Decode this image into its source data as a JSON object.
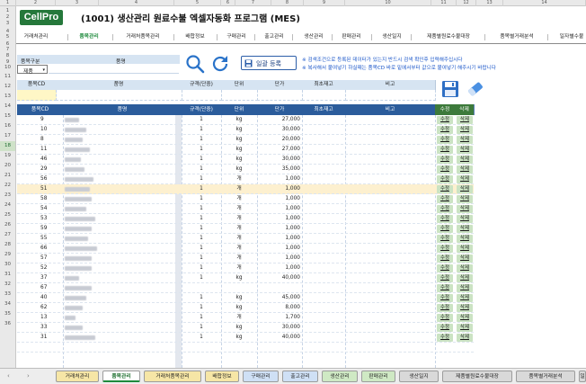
{
  "columns": [
    "1",
    "2",
    "3",
    "4",
    "5",
    "6",
    "7",
    "8",
    "9",
    "10",
    "11",
    "12",
    "13",
    "14"
  ],
  "rows": [
    "1",
    "2",
    "3",
    "4",
    "5",
    "6",
    "7",
    "8",
    "9",
    "10",
    "11",
    "12",
    "13",
    "14",
    "15",
    "16",
    "17",
    "18",
    "19",
    "20",
    "21",
    "22",
    "23",
    "24",
    "25",
    "26",
    "27",
    "28",
    "29",
    "30",
    "31",
    "32",
    "33",
    "34",
    "35",
    "36"
  ],
  "selected_row": "18",
  "logo": "CellPro",
  "title": "(1001) 생산관리 원료수불 엑셀자동화 프로그램 (MES)",
  "nav": [
    {
      "label": "거래처관리",
      "active": false
    },
    {
      "label": "품목관리",
      "active": true
    },
    {
      "label": "거래처품목관리",
      "active": false
    },
    {
      "label": "배합정보",
      "active": false
    },
    {
      "label": "구매관리",
      "active": false
    },
    {
      "label": "출고관리",
      "active": false
    },
    {
      "label": "생산관리",
      "active": false
    },
    {
      "label": "판매관리",
      "active": false
    },
    {
      "label": "생산일지",
      "active": false
    },
    {
      "label": "제품별원료수불대장",
      "active": false
    },
    {
      "label": "품목별거래분석",
      "active": false
    },
    {
      "label": "일자별수불",
      "active": false
    }
  ],
  "search": {
    "type_label": "품목구분",
    "name_label": "품명",
    "type_value": "제품",
    "register_label": "일괄 등록"
  },
  "notices": [
    "※ 검색조건으로 등록된 데이터가 있는지 반드시 검색 확인후 입력해주십시다",
    "※ 복사해서 붙여넣기 하실때는 품목CD 바로 밑에서부터 값으로 붙여넣기 해주시기 바랍니다"
  ],
  "entry_headers": [
    "품목CD",
    "품명",
    "규격(단중)",
    "단위",
    "단가",
    "최초재고",
    "비고"
  ],
  "table_headers": {
    "code": "품목CD",
    "name": "품명",
    "spec": "규격(단중)",
    "unit": "단위",
    "price": "단가",
    "stock": "최초재고",
    "note": "비고",
    "edit": "수정",
    "delete": "삭제"
  },
  "action_labels": {
    "edit": "수정",
    "delete": "삭제"
  },
  "table_rows": [
    {
      "code": "9",
      "name": "",
      "spec": "1",
      "unit": "kg",
      "price": "27,000"
    },
    {
      "code": "10",
      "name": "",
      "spec": "1",
      "unit": "kg",
      "price": "30,000"
    },
    {
      "code": "8",
      "name": "",
      "spec": "1",
      "unit": "kg",
      "price": "20,000"
    },
    {
      "code": "11",
      "name": "",
      "spec": "1",
      "unit": "kg",
      "price": "27,000"
    },
    {
      "code": "46",
      "name": "",
      "spec": "1",
      "unit": "kg",
      "price": "30,000"
    },
    {
      "code": "29",
      "name": "",
      "spec": "1",
      "unit": "kg",
      "price": "35,000"
    },
    {
      "code": "56",
      "name": "",
      "spec": "1",
      "unit": "개",
      "price": "1,000"
    },
    {
      "code": "51",
      "name": "",
      "spec": "1",
      "unit": "개",
      "price": "1,000"
    },
    {
      "code": "58",
      "name": "",
      "spec": "1",
      "unit": "개",
      "price": "1,000"
    },
    {
      "code": "54",
      "name": "",
      "spec": "1",
      "unit": "개",
      "price": "1,000"
    },
    {
      "code": "53",
      "name": "",
      "spec": "1",
      "unit": "개",
      "price": "1,000"
    },
    {
      "code": "59",
      "name": "",
      "spec": "1",
      "unit": "개",
      "price": "1,000"
    },
    {
      "code": "55",
      "name": "",
      "spec": "1",
      "unit": "개",
      "price": "1,000"
    },
    {
      "code": "66",
      "name": "",
      "spec": "1",
      "unit": "개",
      "price": "1,000"
    },
    {
      "code": "57",
      "name": "",
      "spec": "1",
      "unit": "개",
      "price": "1,000"
    },
    {
      "code": "52",
      "name": "",
      "spec": "1",
      "unit": "개",
      "price": "1,000"
    },
    {
      "code": "37",
      "name": "",
      "spec": "1",
      "unit": "kg",
      "price": "40,000"
    },
    {
      "code": "67",
      "name": "",
      "spec": "",
      "unit": "",
      "price": ""
    },
    {
      "code": "40",
      "name": "",
      "spec": "1",
      "unit": "kg",
      "price": "45,000"
    },
    {
      "code": "62",
      "name": "",
      "spec": "1",
      "unit": "kg",
      "price": "8,000"
    },
    {
      "code": "13",
      "name": "",
      "spec": "1",
      "unit": "개",
      "price": "1,700"
    },
    {
      "code": "33",
      "name": "",
      "spec": "1",
      "unit": "kg",
      "price": "30,000"
    },
    {
      "code": "31",
      "name": "",
      "spec": "1",
      "unit": "kg",
      "price": "40,000"
    },
    {
      "code": "",
      "name": "",
      "spec": "",
      "unit": "",
      "price": ""
    }
  ],
  "name_suffixes": [
    "",
    "",
    "",
    "",
    "",
    "",
    "",
    "",
    "",
    "",
    "",
    "",
    "",
    "",
    "",
    "",
    "",
    "",
    "",
    "",
    "",
    "",
    "",
    ""
  ],
  "sheet_tabs": [
    {
      "label": "거래처관리",
      "active": false,
      "color": "#f6e6a6"
    },
    {
      "label": "품목관리",
      "active": true,
      "color": "#ffffff"
    },
    {
      "label": "거래처품목관리",
      "active": false,
      "color": "#f6e6a6"
    },
    {
      "label": "배합정보",
      "active": false,
      "color": "#f6e6a6"
    },
    {
      "label": "구매관리",
      "active": false,
      "color": "#cfe0f5"
    },
    {
      "label": "출고관리",
      "active": false,
      "color": "#cfe0f5"
    },
    {
      "label": "생산관리",
      "active": false,
      "color": "#cfe9c4"
    },
    {
      "label": "판매관리",
      "active": false,
      "color": "#cfe9c4"
    },
    {
      "label": "생산일지",
      "active": false,
      "color": "#d9d9d9"
    },
    {
      "label": "제품별원료수불대장",
      "active": false,
      "color": "#d9d9d9"
    },
    {
      "label": "품목별거래분석",
      "active": false,
      "color": "#d9d9d9"
    },
    {
      "label": "일",
      "active": false,
      "color": "#d9d9d9"
    }
  ],
  "colors": {
    "brand": "#25783b",
    "header_blue": "#2b5c9b",
    "header_green": "#3d7a3b",
    "notice_blue": "#1a56c9",
    "highlight_row": "#fdf0cf"
  }
}
